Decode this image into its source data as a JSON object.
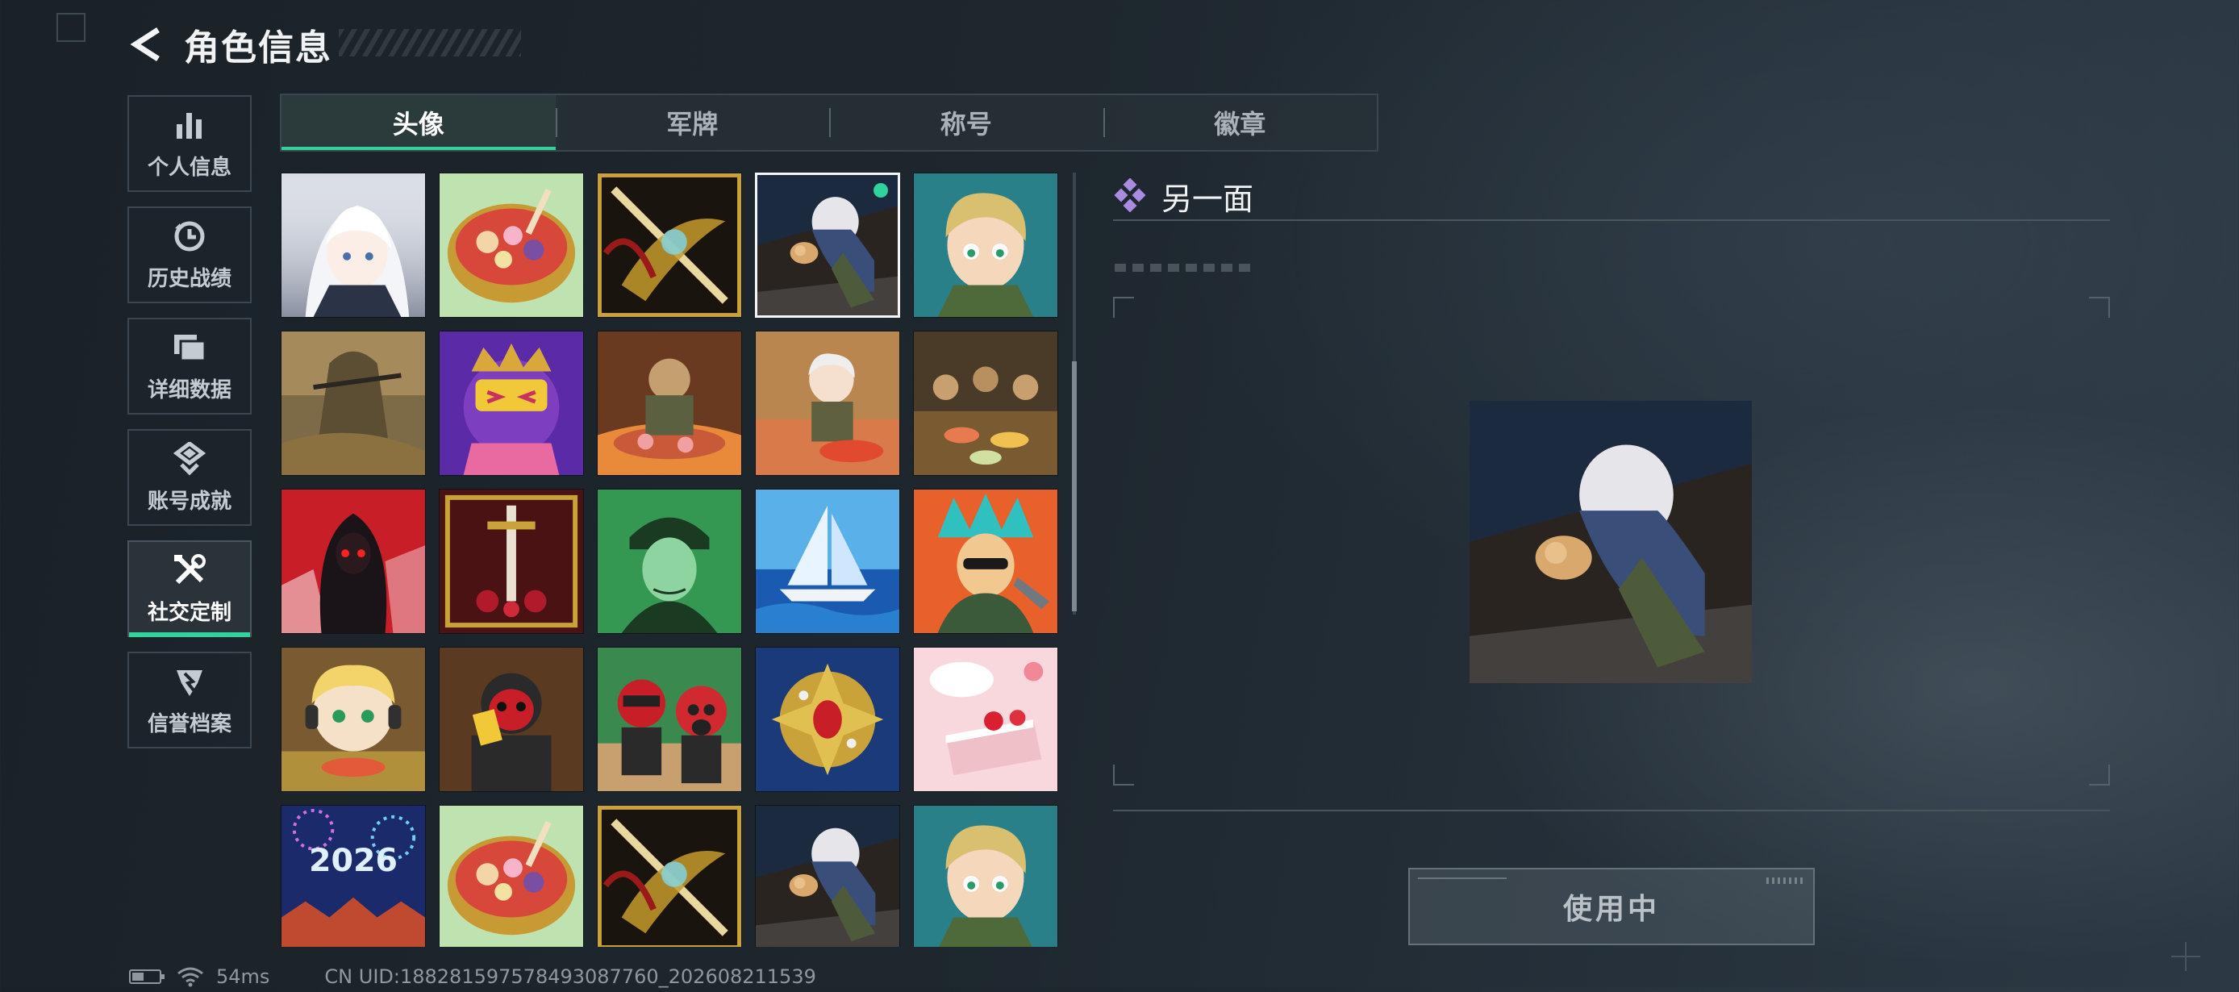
{
  "header": {
    "title": "角色信息"
  },
  "sidebar": {
    "items": [
      {
        "label": "个人信息",
        "icon": "bar-chart-icon"
      },
      {
        "label": "历史战绩",
        "icon": "history-clock-icon"
      },
      {
        "label": "详细数据",
        "icon": "folder-icon"
      },
      {
        "label": "账号成就",
        "icon": "achievement-medal-icon"
      },
      {
        "label": "社交定制",
        "icon": "tools-icon",
        "active": true
      },
      {
        "label": "信誉档案",
        "icon": "credit-badge-icon"
      }
    ]
  },
  "tabs": [
    {
      "label": "头像",
      "active": true
    },
    {
      "label": "军牌"
    },
    {
      "label": "称号"
    },
    {
      "label": "徽章"
    }
  ],
  "avatars": [
    {
      "name": "avatar-white-hair-girl",
      "selected": false
    },
    {
      "name": "avatar-hotpot-bowl",
      "selected": false
    },
    {
      "name": "avatar-golden-dragon-blade",
      "selected": false
    },
    {
      "name": "avatar-cat-soldier",
      "selected": true,
      "in_use": true
    },
    {
      "name": "avatar-cartoon-soldier-boy",
      "selected": false
    },
    {
      "name": "avatar-ghillie-sniper",
      "selected": false
    },
    {
      "name": "avatar-king-crown-bot",
      "selected": false
    },
    {
      "name": "avatar-soldier-bbq",
      "selected": false
    },
    {
      "name": "avatar-cooking-girl",
      "selected": false
    },
    {
      "name": "avatar-squad-feast",
      "selected": false
    },
    {
      "name": "avatar-red-hood-reaper",
      "selected": false
    },
    {
      "name": "avatar-ornate-sword",
      "selected": false
    },
    {
      "name": "avatar-green-soldier-woman",
      "selected": false
    },
    {
      "name": "avatar-sailboat-ocean",
      "selected": false
    },
    {
      "name": "avatar-feather-headdress",
      "selected": false
    },
    {
      "name": "avatar-chibi-blonde-eater",
      "selected": false
    },
    {
      "name": "avatar-red-mask-gold-bar",
      "selected": false
    },
    {
      "name": "avatar-red-gasmask-duo",
      "selected": false
    },
    {
      "name": "avatar-jeweled-brooch",
      "selected": false
    },
    {
      "name": "avatar-strawberry-cake",
      "selected": false
    },
    {
      "name": "avatar-2026-fireworks",
      "selected": false
    },
    {
      "name": "avatar-hotpot-bowl",
      "selected": false
    },
    {
      "name": "avatar-golden-dragon-blade",
      "selected": false
    },
    {
      "name": "avatar-cat-soldier",
      "selected": false
    },
    {
      "name": "avatar-cartoon-soldier-boy",
      "selected": false
    }
  ],
  "detail": {
    "title": "另一面",
    "icon": "diamond-cluster-icon",
    "preview": "avatar-cat-soldier",
    "use_button_label": "使用中"
  },
  "status": {
    "ping": "54ms",
    "uid": "CN UID:1882815975784930877​60_202608211539"
  },
  "colors": {
    "accent": "#31d39c",
    "detail_icon": "#a98be0"
  }
}
